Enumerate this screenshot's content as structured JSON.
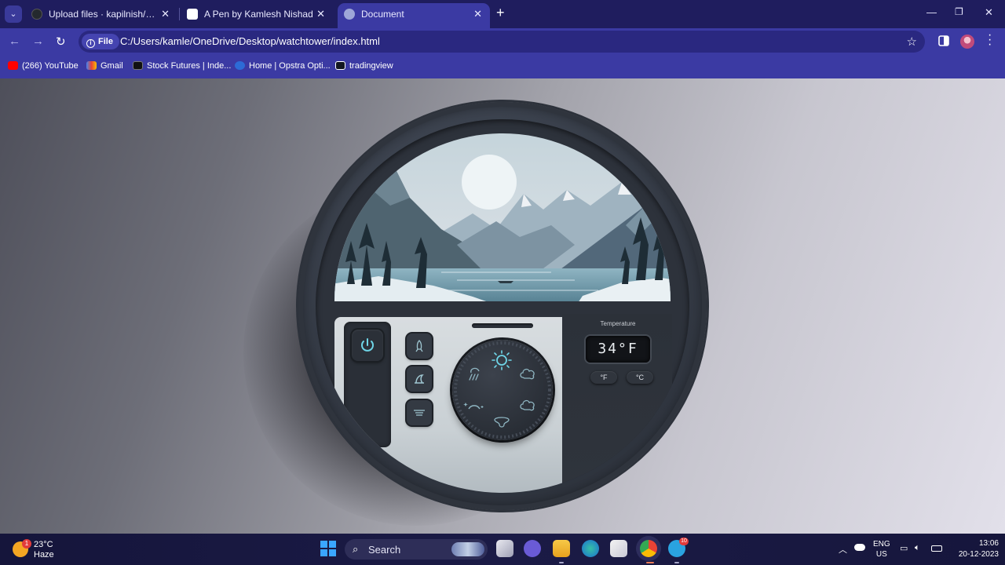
{
  "browser": {
    "tabs": [
      {
        "title": "Upload files · kapilnish/Climate",
        "icon": "github-icon"
      },
      {
        "title": "A Pen by Kamlesh Nishad",
        "icon": "codepen-icon"
      },
      {
        "title": "Document",
        "icon": "globe-icon",
        "active": true
      }
    ],
    "new_tab": "+",
    "chip_label": "File",
    "url": "C:/Users/kamle/OneDrive/Desktop/watchtower/index.html",
    "bookmarks": [
      {
        "label": "(266) YouTube",
        "icon": "youtube-icon",
        "color": "#ff0000"
      },
      {
        "label": "Gmail",
        "icon": "gmail-icon",
        "color": "#ea4335"
      },
      {
        "label": "Stock Futures | Inde...",
        "icon": "investing-icon",
        "color": "#111111"
      },
      {
        "label": "Home | Opstra Opti...",
        "icon": "opstra-icon",
        "color": "#2d6bd6"
      },
      {
        "label": "tradingview",
        "icon": "tradingview-icon",
        "color": "#131722"
      }
    ]
  },
  "widget": {
    "temperature_label": "Temperature",
    "temperature_value": "34°F",
    "unit_f": "°F",
    "unit_c": "°C",
    "accent_color": "#6fd6e8",
    "side_buttons": [
      "rocket-icon",
      "wind-sail-icon",
      "vent-icon"
    ],
    "dial_icons": [
      "sun-icon",
      "cloudy-icon",
      "storm-cloud-icon",
      "fan-icon",
      "night-icon",
      "rain-icon"
    ]
  },
  "taskbar": {
    "weather_temp": "23°C",
    "weather_desc": "Haze",
    "weather_badge": "1",
    "search_label": "Search",
    "telegram_badge": "10",
    "lang_1": "ENG",
    "lang_2": "US",
    "time": "13:06",
    "date": "20-12-2023"
  }
}
